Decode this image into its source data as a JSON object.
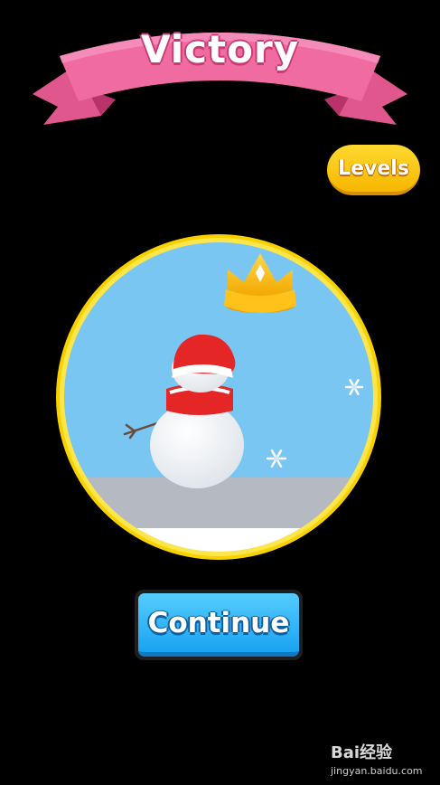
{
  "header": {
    "title": "Victory"
  },
  "levels_button": {
    "label": "Levels"
  },
  "continue_button": {
    "label": "Continue"
  },
  "scene": {
    "character": "snowman",
    "accessories": [
      "santa-hat",
      "red-scarf"
    ],
    "reward_icon": "crown-icon",
    "decorations": [
      "snowflake-icon",
      "snowflake-icon"
    ]
  },
  "watermark": {
    "logo": "Bai经验",
    "url": "jingyan.baidu.com"
  },
  "colors": {
    "banner": "#f06ba0",
    "banner_dark": "#d9457f",
    "levels_button": "#ffc91a",
    "continue_button": "#2fb4f5",
    "sky": "#79c6f2",
    "ring": "#ffd700",
    "background": "#000000"
  }
}
